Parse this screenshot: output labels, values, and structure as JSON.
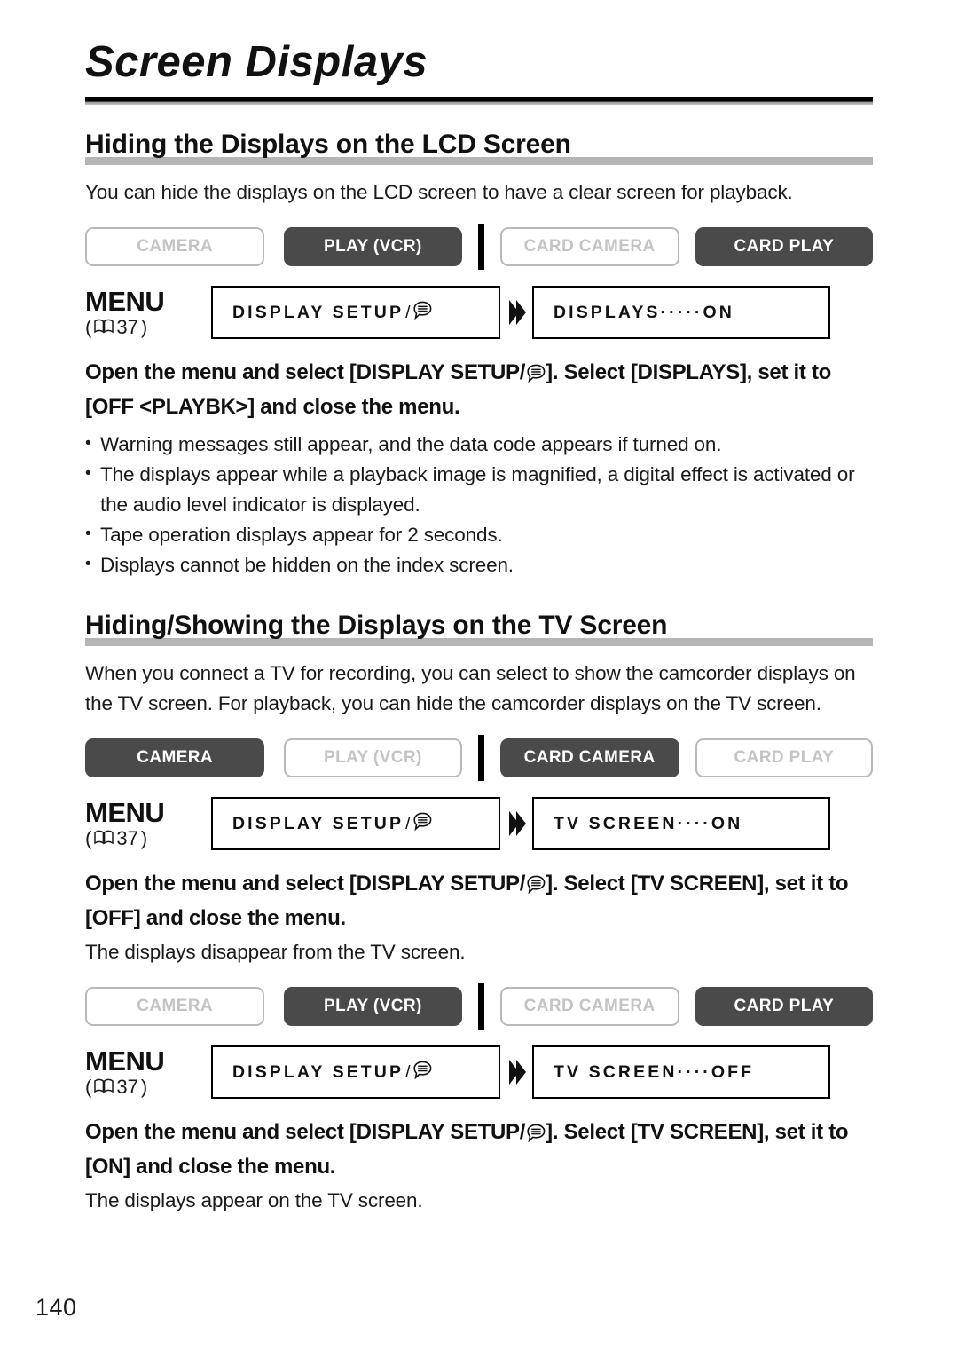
{
  "page": {
    "title": "Screen Displays",
    "number": "140"
  },
  "icons": {
    "book": "book-icon",
    "balloon": "display-balloon-icon",
    "arrow": "double-chevron-right-icon"
  },
  "menu_label": {
    "word": "MENU",
    "ref_open": "(",
    "ref_page": "37",
    "ref_close": ")"
  },
  "modes": {
    "camera": "CAMERA",
    "play_vcr": "PLAY (VCR)",
    "card_camera": "CARD CAMERA",
    "card_play": "CARD PLAY"
  },
  "sections": [
    {
      "heading": "Hiding the Displays on the LCD Screen",
      "intro": "You can hide the displays on the LCD screen to have a clear screen for playback.",
      "mode_states": {
        "camera": "off",
        "play_vcr": "on",
        "card_camera": "off",
        "card_play": "on"
      },
      "menu_path": {
        "box1_label": "DISPLAY SETUP",
        "box1_slash": "/",
        "box2": "DISPLAYS·····ON"
      },
      "instruction_line1": "Open the menu and select [DISPLAY SETUP/",
      "instruction_line1_tail": "]. Select [DISPLAYS], set it to",
      "instruction_line2": "[OFF <PLAYBK>] and close the menu.",
      "bullets": [
        "Warning messages still appear, and the data code appears if turned on.",
        "The displays appear while a playback image is magnified, a digital effect is activated or the audio level indicator is displayed.",
        "Tape operation displays appear for 2 seconds.",
        "Displays cannot be hidden on the index screen."
      ]
    },
    {
      "heading": "Hiding/Showing the Displays on the TV Screen",
      "intro": "When you connect a TV for recording, you can select to show the camcorder displays on the TV screen. For playback, you can hide the camcorder displays on the TV screen.",
      "block_a": {
        "mode_states": {
          "camera": "on",
          "play_vcr": "off",
          "card_camera": "on",
          "card_play": "off"
        },
        "menu_path": {
          "box1_label": "DISPLAY SETUP",
          "box1_slash": "/",
          "box2": "TV SCREEN····ON"
        },
        "instruction_line1": "Open the menu and select [DISPLAY SETUP/",
        "instruction_line1_tail": "]. Select [TV SCREEN], set it",
        "instruction_line2": "to [OFF] and close the menu.",
        "result": "The displays disappear from the TV screen."
      },
      "block_b": {
        "mode_states": {
          "camera": "off",
          "play_vcr": "on",
          "card_camera": "off",
          "card_play": "on"
        },
        "menu_path": {
          "box1_label": "DISPLAY SETUP",
          "box1_slash": "/",
          "box2": "TV SCREEN····OFF"
        },
        "instruction_line1": "Open the menu and select [DISPLAY SETUP/",
        "instruction_line1_tail": "]. Select [TV SCREEN], set it",
        "instruction_line2": "to [ON] and close the menu.",
        "result": "The displays appear on the TV screen."
      }
    }
  ],
  "colors": {
    "active_button": "#4a4a4a",
    "inactive_border": "#b9b9b9",
    "inactive_text": "#c4c4c4",
    "heading_bar": "#b5b5b5",
    "title_rule": "#000000"
  }
}
